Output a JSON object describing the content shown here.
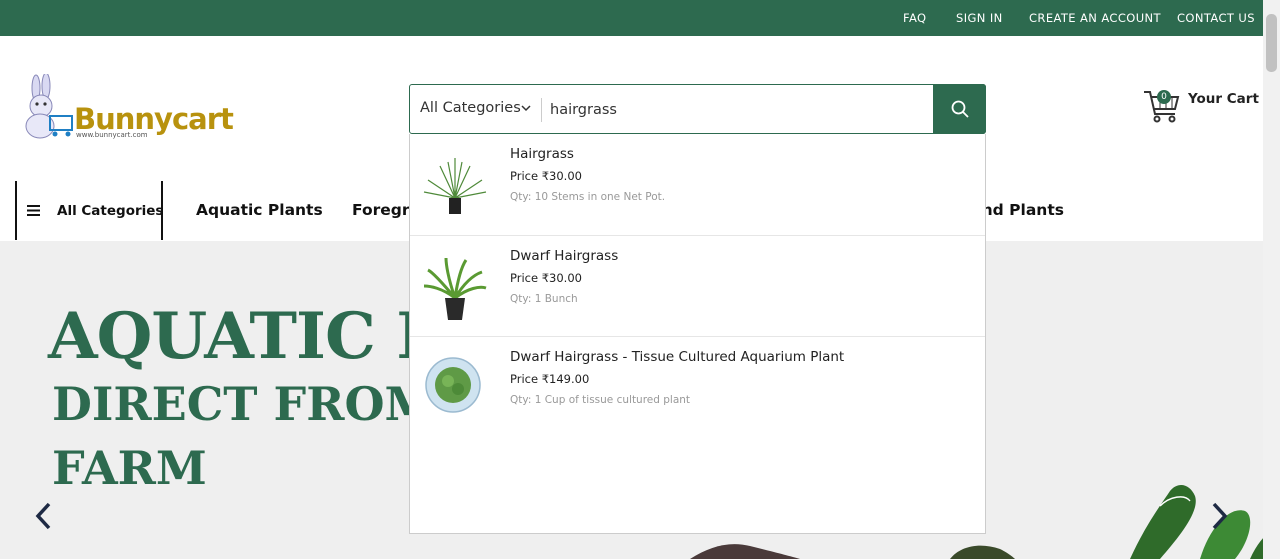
{
  "topbar": {
    "links": [
      "FAQ",
      "SIGN IN",
      "CREATE AN ACCOUNT",
      "CONTACT US"
    ]
  },
  "logo": {
    "brand": "Bunnycart",
    "url_text": "www.bunnycart.com"
  },
  "search": {
    "category_label": "All Categories",
    "query": "hairgrass"
  },
  "cart": {
    "count": "0",
    "label": "Your Cart"
  },
  "nav": {
    "all_label": "All Categories",
    "items": [
      "Aquatic Plants",
      "Foregro",
      "ond Plants"
    ]
  },
  "hero": {
    "line1": "AQUATIC P",
    "line2": "DIRECT FROM",
    "line3": "FARM"
  },
  "results": [
    {
      "name": "Hairgrass",
      "price": "Price ₹30.00",
      "qty": "Qty: 10 Stems in one Net Pot."
    },
    {
      "name": "Dwarf Hairgrass",
      "price": "Price ₹30.00",
      "qty": "Qty: 1 Bunch"
    },
    {
      "name": "Dwarf Hairgrass - Tissue Cultured Aquarium Plant",
      "price": "Price ₹149.00",
      "qty": "Qty: 1 Cup of tissue cultured plant"
    }
  ],
  "colors": {
    "brand_green": "#2d6a4f",
    "hero_bg": "#efefef"
  },
  "icons": [
    "search-icon",
    "chevron-down-icon",
    "cart-icon",
    "hamburger-icon",
    "arrow-left-icon",
    "arrow-right-icon"
  ]
}
